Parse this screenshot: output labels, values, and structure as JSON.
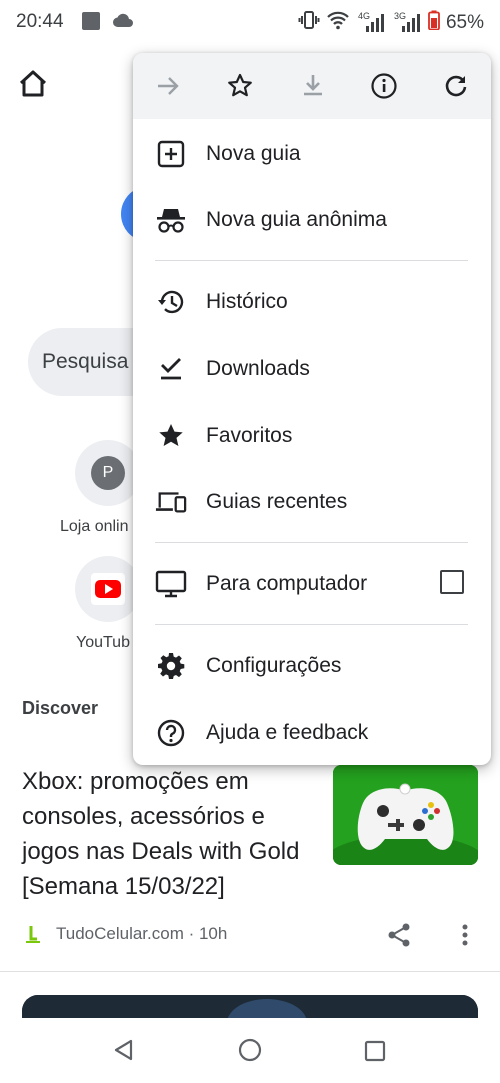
{
  "status_bar": {
    "time": "20:44",
    "network_4g": "4G",
    "network_3g": "3G",
    "battery": "65%"
  },
  "background": {
    "search_placeholder": "Pesquisa",
    "tiles": [
      {
        "letter": "P",
        "label": "Loja onlin"
      },
      {
        "label": "YouTub"
      }
    ],
    "discover_heading": "Discover",
    "article": {
      "title": "Xbox: promoções em consoles, acessórios e jogos nas Deals with Gold [Semana 15/03/22]",
      "source": "TudoCelular.com · 10h"
    }
  },
  "menu": {
    "toolbar": [
      "forward-icon",
      "star-outline-icon",
      "download-icon",
      "info-icon",
      "refresh-icon"
    ],
    "items": [
      {
        "label": "Nova guia",
        "icon": "new-tab-icon"
      },
      {
        "label": "Nova guia anônima",
        "icon": "incognito-icon"
      },
      {
        "label": "Histórico",
        "icon": "history-icon"
      },
      {
        "label": "Downloads",
        "icon": "download-done-icon"
      },
      {
        "label": "Favoritos",
        "icon": "star-filled-icon"
      },
      {
        "label": "Guias recentes",
        "icon": "devices-icon"
      },
      {
        "label": "Para computador",
        "icon": "desktop-icon",
        "checked": false
      },
      {
        "label": "Configurações",
        "icon": "gear-icon"
      },
      {
        "label": "Ajuda e feedback",
        "icon": "help-icon"
      }
    ]
  },
  "colors": {
    "menu_toolbar_bg": "#f1f3f4",
    "icon": "#202124",
    "disabled_icon": "#9aa0a6",
    "thumbnail_green": "#24a11e"
  }
}
